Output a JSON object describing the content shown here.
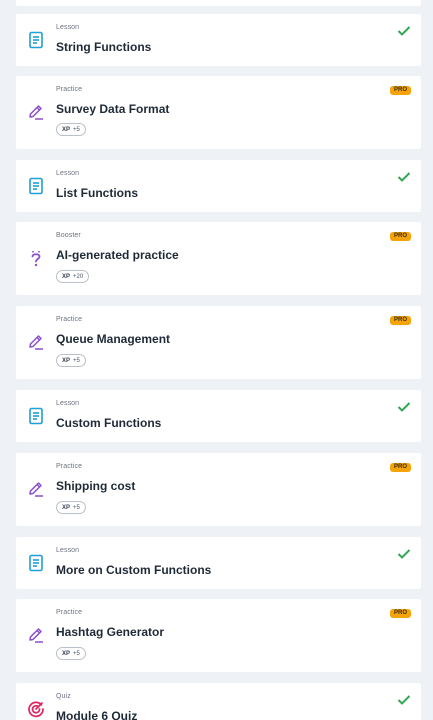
{
  "colors": {
    "lesson_icon": "#1e9fd8",
    "practice_icon": "#8b4fc9",
    "quiz_icon": "#e0245e",
    "check": "#33a853",
    "pro_badge": "#f5a30a"
  },
  "items": [
    {
      "kind": "Lesson",
      "title": "String Functions",
      "icon": "lesson-icon",
      "status": "completed"
    },
    {
      "kind": "Practice",
      "title": "Survey Data Format",
      "icon": "practice-pencil-icon",
      "badge": "PRO",
      "xp_label": "XP",
      "xp_value": "+5"
    },
    {
      "kind": "Lesson",
      "title": "List Functions",
      "icon": "lesson-icon",
      "status": "completed"
    },
    {
      "kind": "Booster",
      "title": "AI-generated practice",
      "icon": "booster-question-icon",
      "badge": "PRO",
      "xp_label": "XP",
      "xp_value": "+20"
    },
    {
      "kind": "Practice",
      "title": "Queue Management",
      "icon": "practice-pencil-icon",
      "badge": "PRO",
      "xp_label": "XP",
      "xp_value": "+5"
    },
    {
      "kind": "Lesson",
      "title": "Custom Functions",
      "icon": "lesson-icon",
      "status": "completed"
    },
    {
      "kind": "Practice",
      "title": "Shipping cost",
      "icon": "practice-pencil-icon",
      "badge": "PRO",
      "xp_label": "XP",
      "xp_value": "+5"
    },
    {
      "kind": "Lesson",
      "title": "More on Custom Functions",
      "icon": "lesson-icon",
      "status": "completed"
    },
    {
      "kind": "Practice",
      "title": "Hashtag Generator",
      "icon": "practice-pencil-icon",
      "badge": "PRO",
      "xp_label": "XP",
      "xp_value": "+5"
    },
    {
      "kind": "Quiz",
      "title": "Module 6 Quiz",
      "icon": "quiz-target-icon",
      "status": "completed"
    }
  ]
}
